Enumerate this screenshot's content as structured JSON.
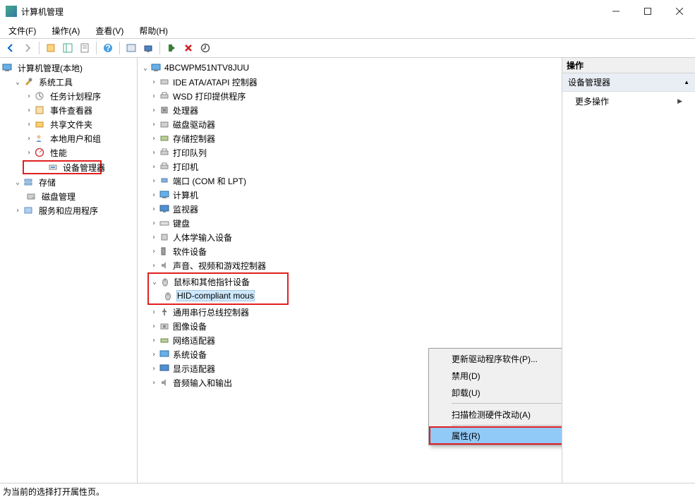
{
  "window": {
    "title": "计算机管理"
  },
  "menus": {
    "file": "文件(F)",
    "action": "操作(A)",
    "view": "查看(V)",
    "help": "帮助(H)"
  },
  "left_tree": {
    "root": "计算机管理(本地)",
    "sys_tools": "系统工具",
    "task_sched": "任务计划程序",
    "event_viewer": "事件查看器",
    "shared_folders": "共享文件夹",
    "local_users": "本地用户和组",
    "performance": "性能",
    "device_mgr": "设备管理器",
    "storage": "存储",
    "disk_mgmt": "磁盘管理",
    "services_apps": "服务和应用程序"
  },
  "devices": {
    "computer_name": "4BCWPM51NTV8JUU",
    "ide": "IDE ATA/ATAPI 控制器",
    "wsd": "WSD 打印提供程序",
    "cpu": "处理器",
    "disk_drive": "磁盘驱动器",
    "storage_ctrl": "存储控制器",
    "print_queue": "打印队列",
    "printer": "打印机",
    "ports": "端口 (COM 和 LPT)",
    "computer": "计算机",
    "monitor": "监视器",
    "keyboard": "键盘",
    "hid": "人体学输入设备",
    "software": "软件设备",
    "sound": "声音、视频和游戏控制器",
    "mouse_category": "鼠标和其他指针设备",
    "mouse_device": "HID-compliant mous",
    "usb": "通用串行总线控制器",
    "imaging": "图像设备",
    "network": "网络适配器",
    "system": "系统设备",
    "display": "显示适配器",
    "audio_io": "音频输入和输出"
  },
  "context_menu": {
    "update_driver": "更新驱动程序软件(P)...",
    "disable": "禁用(D)",
    "uninstall": "卸载(U)",
    "scan_hw": "扫描检测硬件改动(A)",
    "properties": "属性(R)"
  },
  "actions": {
    "header": "操作",
    "group": "设备管理器",
    "more": "更多操作"
  },
  "statusbar": "为当前的选择打开属性页。"
}
